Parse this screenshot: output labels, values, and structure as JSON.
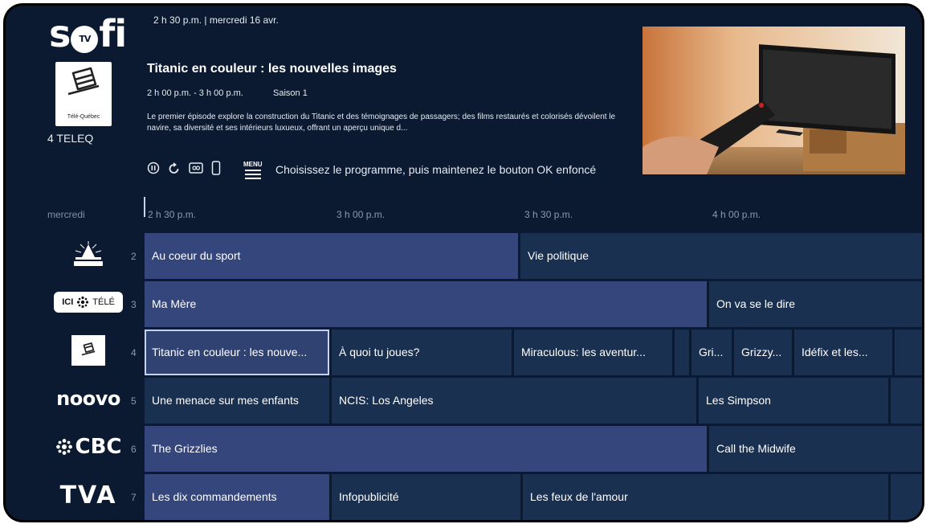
{
  "header": {
    "app_logo": "sofi",
    "app_logo_badge": "TV",
    "clock": "2 h 30 p.m.  |  mercredi 16 avr.",
    "channel_logo_caption": "Télé-Québec",
    "channel": "4  TELEQ",
    "program": {
      "title": "Titanic en couleur : les nouvelles images",
      "time": "2 h 00 p.m. - 3 h 00 p.m.",
      "season": "Saison 1",
      "description": "Le premier épisode explore la construction du Titanic et des témoignages de passagers; des films restaurés et colorisés dévoilent le navire, sa diversité et ses intérieurs luxueux, offrant un aperçu unique d..."
    },
    "icons": [
      "pause-icon",
      "restart-icon",
      "record-icon",
      "mobile-icon"
    ],
    "menu_label": "MENU",
    "hint": "Choisissez le programme, puis maintenez le bouton OK enfoncé"
  },
  "guide": {
    "day": "mercredi",
    "times": [
      "2 h 30 p.m.",
      "3 h 00 p.m.",
      "3 h 30 p.m.",
      "4 h 00 p.m."
    ],
    "rows": [
      {
        "number": "2",
        "logo": "TÉLÉ-CULTURE",
        "programs": [
          "Au coeur du sport",
          "Vie politique"
        ]
      },
      {
        "number": "3",
        "logo": "ICI TÉLÉ",
        "programs": [
          "Ma Mère",
          "On va se le dire"
        ]
      },
      {
        "number": "4",
        "logo": "Télé-Québec",
        "programs": [
          "Titanic en couleur : les nouve...",
          "À quoi tu joues?",
          "Miraculous: les aventur...",
          "",
          "Gri...",
          "Grizzy...",
          "Idéfix et les..."
        ]
      },
      {
        "number": "5",
        "logo": "noovo",
        "programs": [
          "Une menace sur mes enfants",
          "NCIS: Los Angeles",
          "Les Simpson"
        ]
      },
      {
        "number": "6",
        "logo": "CBC",
        "programs": [
          "The Grizzlies",
          "Call the Midwife"
        ]
      },
      {
        "number": "7",
        "logo": "TVA",
        "programs": [
          "Les dix commandements",
          "Infopublicité",
          "Les feux de l'amour"
        ]
      }
    ]
  },
  "colors": {
    "background": "#0b1a30",
    "cell": "#1a3050",
    "cell_current": "#34467c",
    "selected_border": "#c6d2f3"
  }
}
